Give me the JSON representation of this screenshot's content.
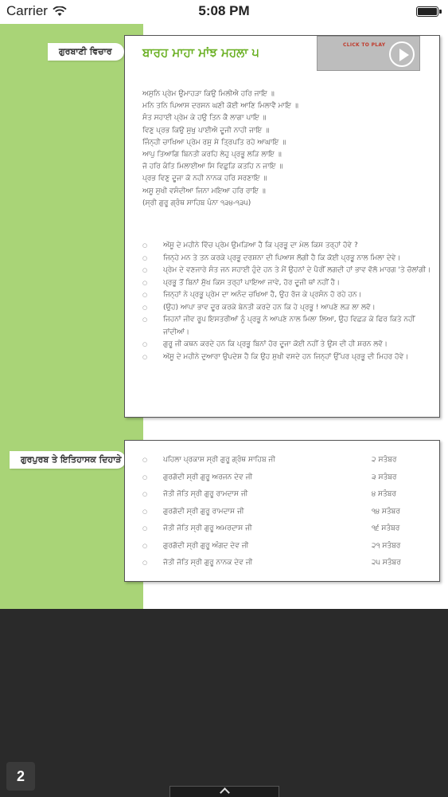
{
  "status_bar": {
    "carrier": "Carrier",
    "time": "5:08 PM",
    "battery_level": 1.0
  },
  "gurbani_section": {
    "tag": "ਗੁਰਬਾਣੀ ਵਿਚਾਰ",
    "title": "ਬਾਰਹ ਮਾਹਾ ਮਾਂਝ ਮਹਲਾ ੫",
    "video": {
      "cta": "CLICK TO PLAY"
    },
    "verses": [
      "ਅਸੁਨਿ ਪ੍ਰੇਮ ਉਮਾਹੜਾ ਕਿਉ ਮਿਲੀਐ ਹਰਿ ਜਾਇ ॥",
      "ਮਨਿ ਤਨਿ ਪਿਆਸ ਦਰਸਨ ਘਣੀ ਕੋਈ ਆਣਿ ਮਿਲਾਵੈ ਮਾਇ ॥",
      "ਸੰਤ ਸਹਾਈ ਪ੍ਰੇਮ ਕੇ ਹਉ ਤਿਨ ਕੈ ਲਾਗਾ ਪਾਇ ॥",
      "ਵਿਣੁ ਪ੍ਰਭ ਕਿਉ ਸੁਖੁ ਪਾਈਐ ਦੂਜੀ ਨਾਹੀ ਜਾਇ ॥",
      "ਜਿੰਨ੍ਹੀ ਚਾਖਿਆ ਪ੍ਰੇਮ ਰਸੁ ਸੇ ਤ੍ਰਿਪਤਿ ਰਹੇ ਆਘਾਇ ॥",
      "ਆਪੁ ਤਿਆਗਿ ਬਿਨਤੀ ਕਰਹਿ ਲੇਹੁ ਪ੍ਰਭੂ ਲੜਿ ਲਾਇ ॥",
      "ਜੋ ਹਰਿ ਕੰਤਿ ਮਿਲਾਈਆ ਸਿ ਵਿਛੁੜਿ ਕਤਹਿ ਨ ਜਾਇ ॥",
      "ਪ੍ਰਭ ਵਿਣੁ ਦੂਜਾ ਕੋ ਨਹੀ ਨਾਨਕ ਹਰਿ ਸਰਣਾਇ ॥",
      "ਅਸੂ ਸੁਖੀ ਵਸੰਦੀਆ ਜਿਨਾ ਮਇਆ ਹਰਿ ਰਾਇ ॥",
      "(ਸ੍ਰੀ ਗੁਰੂ ਗ੍ਰੰਥ ਸਾਹਿਬ ਪੰਨਾ ੧੩੪-੧੩੫)"
    ],
    "explanations": [
      "ਅੱਸੂ ਦੇ ਮਹੀਨੇ ਵਿੱਚ ਪ੍ਰੇਮ ਉਮੜਿਆ ਹੈ ਕਿ ਪ੍ਰਭੂ ਦਾ ਮੇਲ ਕਿਸ ਤਰ੍ਹਾਂ ਹੋਵੇ ?",
      "ਜਿਨ੍ਹੇ ਮਨ ਤੇ ਤਨ ਕਰਕੇ ਪ੍ਰਭੂ ਦਰਸ਼ਨਾ ਦੀ ਪਿਆਸ ਲੱਗੀ ਹੈ ਕਿ ਕੋਈ ਪ੍ਰਭੂ ਨਾਲ ਮਿਲਾ ਦੇਵੇ।",
      "ਪ੍ਰੇਮ ਦੇ ਵਣਜਾਰੇ ਸੰਤ ਜਨ ਸਹਾਈ ਹੁੰਦੇ ਹਨ ਤੇ ਮੈਂ ਉਹਨਾਂ ਦੇ ਪੈਰੀਂ ਲਗਦੀ ਹਾਂ ਭਾਵ ਵੱਲੋ ਮਾਰਗ 'ਤੇ ਚੱਲਾਂਗੀ।",
      "ਪ੍ਰਭੂ ਤੋਂ ਬਿਨਾਂ ਸੁੱਖ ਕਿਸ ਤਰ੍ਹਾਂ ਪਾਇਆ ਜਾਵੇ, ਹੋਰ ਦੂਜੀ ਥਾਂ ਨਹੀਂ ਹੈ।",
      "ਜਿਨ੍ਹਾਂ ਨੇ ਪ੍ਰਭੂ ਪ੍ਰੇਮ ਦਾ ਅਨੰਦ ਚਖਿਆ ਹੈ, ਉਹ ਰੱਜ ਕੇ ਪ੍ਰਸੰਨ ਹੋ ਰਹੇ ਹਨ।",
      "(ਉਹ) ਆਪਾ ਭਾਵ ਦੂਰ ਕਰਕੇ ਬੇਨਤੀ ਕਰਦੇ ਹਨ ਕਿ ਹੇ ਪ੍ਰਭੂ ! ਆਪਣੇ ਲੜ ਲਾ ਲਵੋ।",
      "ਜਿਹਨਾਂ ਜੀਵ ਰੂਪ ਇਸਤਰੀਆਂ ਨੂੰ ਪ੍ਰਭੂ ਨੇ ਆਪਣੇ ਨਾਲ ਮਿਲਾ ਲਿਆ, ਉਹ ਵਿਛੜ ਕੇ ਫਿਰ ਕਿਤੇ ਨਹੀਂ ਜਾਂਦੀਆਂ।",
      "ਗੁਰੂ ਜੀ ਕਥਨ ਕਰਦੇ ਹਨ ਕਿ ਪ੍ਰਭੂ ਬਿਨਾਂ ਹੋਰ ਦੂਜਾ ਕੋਈ ਨਹੀਂ ਤੇ ਉਸ ਦੀ ਹੀ ਸ਼ਰਨ ਲਵੋ।",
      "ਅੱਸੂ ਦੇ ਮਹੀਨੇ ਦੁਆਰਾ ਉਪਦੇਸ਼ ਹੈ ਕਿ ਉਹ ਸੁਖੀ ਵਸਦੇ ਹਨ ਜਿਨ੍ਹਾਂ ਉੱਪਰ ਪ੍ਰਭੂ ਦੀ ਮਿਹਰ ਹੋਵੇ।"
    ]
  },
  "gurpurab_section": {
    "tag": "ਗੁਰਪੁਰਬ ਤੇ ਇਤਿਹਾਸਕ ਦਿਹਾੜੇ",
    "rows": [
      {
        "event": "ਪਹਿਲਾ ਪ੍ਰਕਾਸ਼ ਸ੍ਰੀ ਗੁਰੂ ਗ੍ਰੰਥ ਸਾਹਿਬ ਜੀ",
        "date": "੨ ਸਤੰਬਰ"
      },
      {
        "event": "ਗੁਰਗੱਦੀ ਸ੍ਰੀ ਗੁਰੂ ਅਰਜਨ ਦੇਵ ਜੀ",
        "date": "੩ ਸਤੰਬਰ"
      },
      {
        "event": "ਜੋਤੀ ਜੋਤਿ ਸ੍ਰੀ ਗੁਰੂ ਰਾਮਦਾਸ ਜੀ",
        "date": "੪ ਸਤੰਬਰ"
      },
      {
        "event": "ਗੁਰਗੱਦੀ ਸ੍ਰੀ ਗੁਰੂ ਰਾਮਦਾਸ ਜੀ",
        "date": "੧੪ ਸਤੰਬਰ"
      },
      {
        "event": "ਜੋਤੀ ਜੋਤਿ ਸ੍ਰੀ ਗੁਰੂ ਅਮਰਦਾਸ ਜੀ",
        "date": "੧੬ ਸਤੰਬਰ"
      },
      {
        "event": "ਗੁਰਗੱਦੀ ਸ੍ਰੀ ਗੁਰੂ ਅੰਗਦ ਦੇਵ ਜੀ",
        "date": "੨੧ ਸਤੰਬਰ"
      },
      {
        "event": "ਜੋਤੀ ਜੋਤਿ ਸ੍ਰੀ ਗੁਰੂ ਨਾਨਕ ਦੇਵ ਜੀ",
        "date": "੨੫ ਸਤੰਬਰ"
      }
    ]
  },
  "footer": {
    "page_number": "2",
    "handle_icon": "chevron-up-icon"
  },
  "colors": {
    "accent_green": "#a9d477",
    "title_green": "#6ab023",
    "play_label_red": "#c0392b",
    "dark_background": "#2a2a2a"
  }
}
